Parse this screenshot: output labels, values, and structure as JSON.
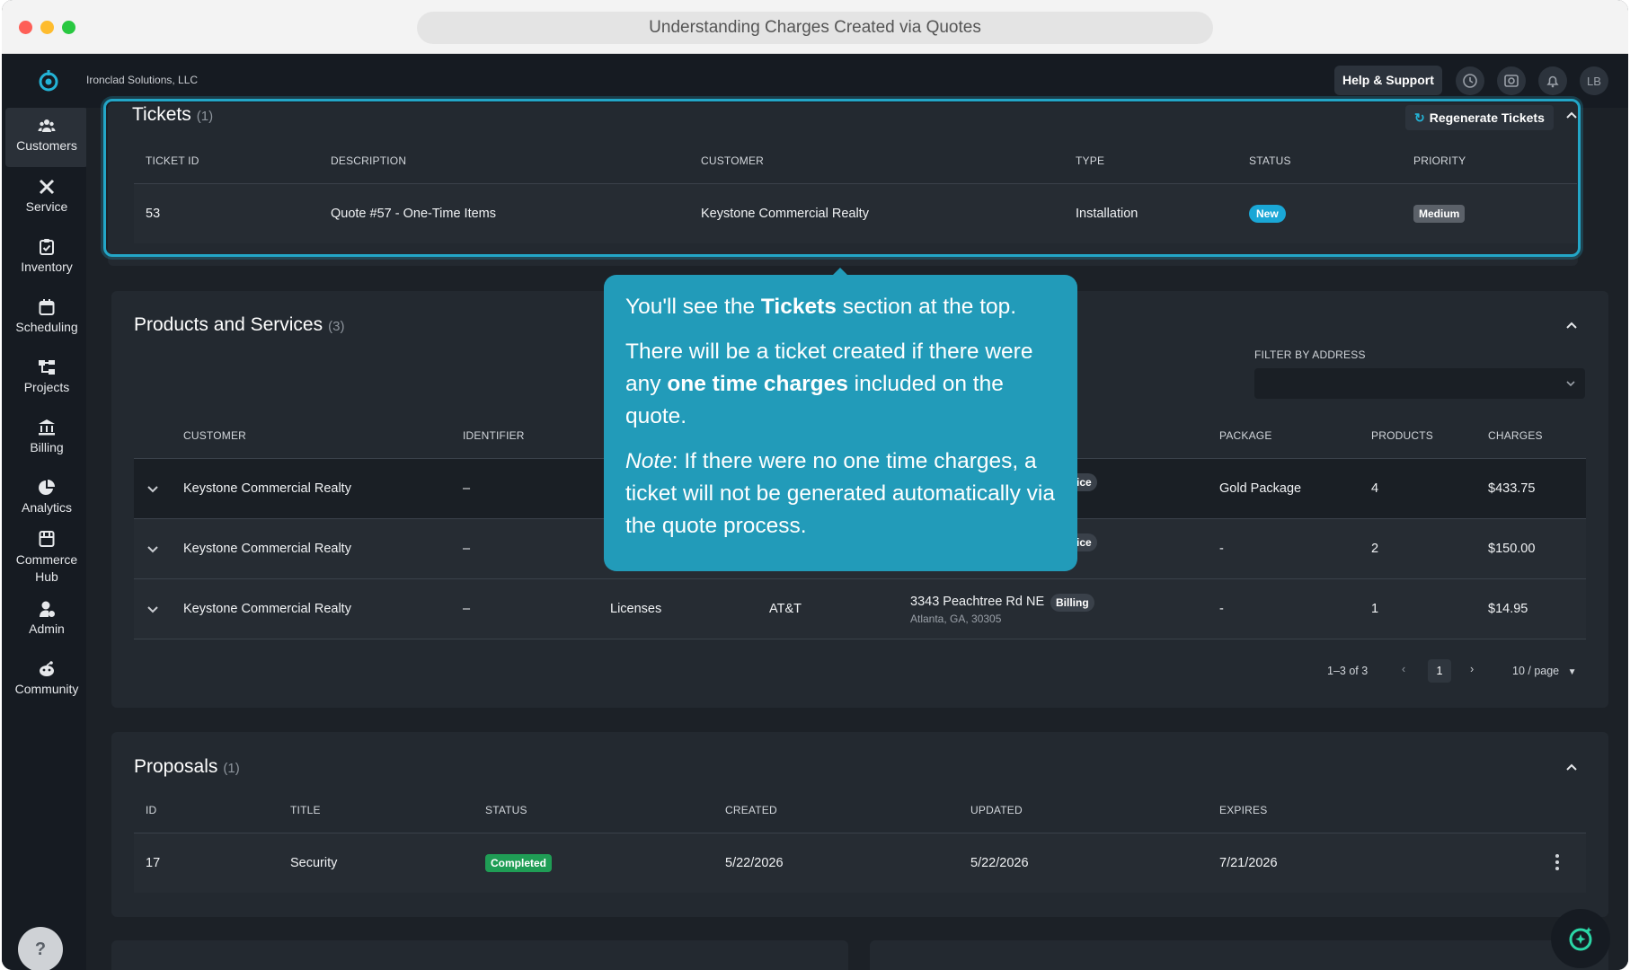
{
  "browser": {
    "title": "Understanding Charges Created via Quotes"
  },
  "header": {
    "org_name": "Ironclad Solutions, LLC",
    "help_label": "Help & Support",
    "avatar_initials": "LB"
  },
  "sidebar": {
    "items": [
      {
        "label": "Customers",
        "icon": "users-icon",
        "active": true
      },
      {
        "label": "Service",
        "icon": "tools-icon"
      },
      {
        "label": "Inventory",
        "icon": "clipboard-icon"
      },
      {
        "label": "Scheduling",
        "icon": "calendar-icon"
      },
      {
        "label": "Projects",
        "icon": "hierarchy-icon"
      },
      {
        "label": "Billing",
        "icon": "bank-icon"
      },
      {
        "label": "Analytics",
        "icon": "pie-chart-icon"
      },
      {
        "label": "Commerce Hub",
        "icon": "store-icon"
      },
      {
        "label": "Admin",
        "icon": "admin-icon"
      },
      {
        "label": "Community",
        "icon": "community-icon"
      }
    ],
    "help_glyph": "?"
  },
  "tickets": {
    "title": "Tickets",
    "count": "(1)",
    "regenerate_label": "Regenerate Tickets",
    "columns": [
      "TICKET ID",
      "DESCRIPTION",
      "CUSTOMER",
      "TYPE",
      "STATUS",
      "PRIORITY"
    ],
    "rows": [
      {
        "id": "53",
        "description": "Quote #57 - One-Time Items",
        "customer": "Keystone Commercial Realty",
        "type": "Installation",
        "status": "New",
        "priority": "Medium"
      }
    ]
  },
  "products": {
    "title": "Products and Services",
    "count": "(3)",
    "filter_label": "FILTER BY ADDRESS",
    "columns": [
      "CUSTOMER",
      "IDENTIFIER",
      "PACKAGE",
      "PRODUCTS",
      "CHARGES"
    ],
    "rows": [
      {
        "customer": "Keystone Commercial Realty",
        "identifier": "–",
        "badge_partial": "ice",
        "package": "Gold Package",
        "products": "4",
        "charges": "$433.75"
      },
      {
        "customer": "Keystone Commercial Realty",
        "identifier": "–",
        "badge_partial": "ice",
        "package": "-",
        "products": "2",
        "charges": "$150.00"
      },
      {
        "customer": "Keystone Commercial Realty",
        "identifier": "–",
        "category": "Licenses",
        "vendor": "AT&T",
        "address_line1": "3343 Peachtree Rd NE",
        "address_line2": "Atlanta, GA, 30305",
        "address_badge": "Billing",
        "package": "-",
        "products": "1",
        "charges": "$14.95"
      }
    ],
    "pager": {
      "range": "1–3 of 3",
      "page": "1",
      "per_page": "10 / page"
    }
  },
  "proposals": {
    "title": "Proposals",
    "count": "(1)",
    "columns": [
      "ID",
      "TITLE",
      "STATUS",
      "CREATED",
      "UPDATED",
      "EXPIRES"
    ],
    "rows": [
      {
        "id": "17",
        "title": "Security",
        "status": "Completed",
        "created": "5/22/2026",
        "updated": "5/22/2026",
        "expires": "7/21/2026"
      }
    ]
  },
  "tooltip": {
    "p1_pre": "You'll see the ",
    "p1_bold": "Tickets",
    "p1_post": " section at the top.",
    "p2_pre": "There will be a ticket created if there were any ",
    "p2_bold": "one time charges",
    "p2_post": " included on the quote.",
    "p3_italic": "Note",
    "p3_post": ": If there were no one time charges, a ticket will not be generated automatically via the quote process."
  },
  "colors": {
    "accent": "#229bb9",
    "status_new": "#1aa7d6",
    "status_completed": "#1f9d55",
    "priority_medium": "#5b6169"
  }
}
